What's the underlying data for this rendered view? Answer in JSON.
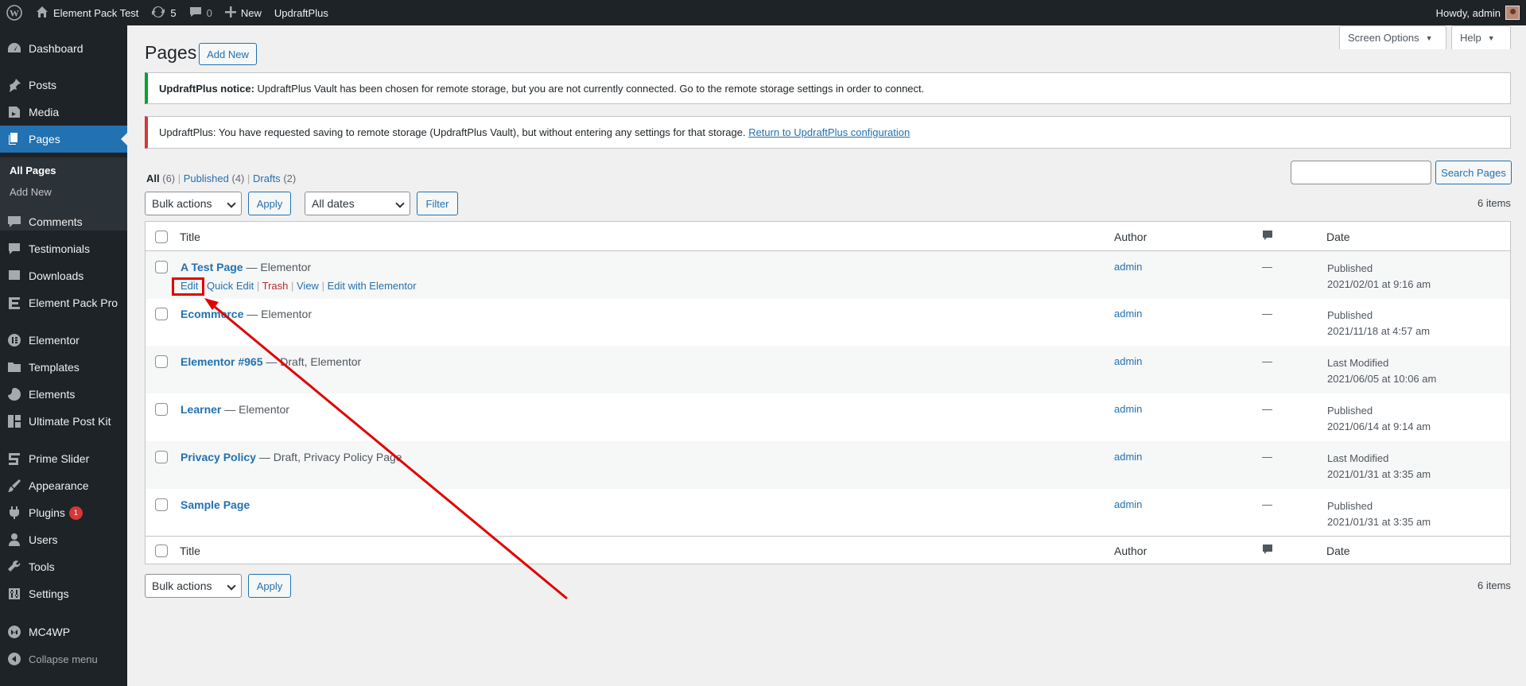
{
  "adminbar": {
    "site_name": "Element Pack Test",
    "updates_count": "5",
    "comments_count": "0",
    "new_label": "New",
    "plugin_label": "UpdraftPlus",
    "howdy": "Howdy, admin"
  },
  "sidebar": {
    "items": [
      {
        "label": "Dashboard",
        "icon": "dashboard-icon"
      },
      {
        "label": "Posts",
        "icon": "pin-icon"
      },
      {
        "label": "Media",
        "icon": "media-icon"
      },
      {
        "label": "Pages",
        "icon": "pages-icon"
      },
      {
        "label": "Comments",
        "icon": "comment-icon"
      },
      {
        "label": "Testimonials",
        "icon": "testimonial-icon"
      },
      {
        "label": "Downloads",
        "icon": "download-icon"
      },
      {
        "label": "Element Pack Pro",
        "icon": "element-pack-icon"
      },
      {
        "label": "Elementor",
        "icon": "elementor-icon"
      },
      {
        "label": "Templates",
        "icon": "folder-icon"
      },
      {
        "label": "Elements",
        "icon": "elements-icon"
      },
      {
        "label": "Ultimate Post Kit",
        "icon": "post-kit-icon"
      },
      {
        "label": "Prime Slider",
        "icon": "slider-icon"
      },
      {
        "label": "Appearance",
        "icon": "brush-icon"
      },
      {
        "label": "Plugins",
        "icon": "plugin-icon",
        "badge": "1"
      },
      {
        "label": "Users",
        "icon": "user-icon"
      },
      {
        "label": "Tools",
        "icon": "wrench-icon"
      },
      {
        "label": "Settings",
        "icon": "settings-icon"
      },
      {
        "label": "MC4WP",
        "icon": "mc4wp-icon"
      },
      {
        "label": "Collapse menu",
        "icon": "collapse-icon"
      }
    ],
    "submenu": [
      "All Pages",
      "Add New"
    ]
  },
  "header": {
    "title": "Pages",
    "add_new": "Add New",
    "screen_options": "Screen Options",
    "help": "Help"
  },
  "notices": {
    "n1_bold": "UpdraftPlus notice:",
    "n1_text": " UpdraftPlus Vault has been chosen for remote storage, but you are not currently connected. Go to the remote storage settings in order to connect.",
    "n2_text": "UpdraftPlus: You have requested saving to remote storage (UpdraftPlus Vault), but without entering any settings for that storage. ",
    "n2_link": "Return to UpdraftPlus configuration"
  },
  "filters": {
    "all": "All",
    "all_count": "(6)",
    "published": "Published",
    "published_count": "(4)",
    "drafts": "Drafts",
    "drafts_count": "(2)",
    "search_button": "Search Pages",
    "bulk_actions": "Bulk actions",
    "apply": "Apply",
    "all_dates": "All dates",
    "filter": "Filter",
    "items_count": "6 items"
  },
  "table": {
    "col_title": "Title",
    "col_author": "Author",
    "col_date": "Date",
    "row_actions": {
      "edit": "Edit",
      "quick_edit": "Quick Edit",
      "trash": "Trash",
      "view": "View",
      "edit_elementor": "Edit with Elementor"
    },
    "rows": [
      {
        "title": "A Test Page",
        "state": " — Elementor",
        "author": "admin",
        "comments": "—",
        "status": "Published",
        "date": "2021/02/01 at 9:16 am"
      },
      {
        "title": "Ecommerce",
        "state": " — Elementor",
        "author": "admin",
        "comments": "—",
        "status": "Published",
        "date": "2021/11/18 at 4:57 am"
      },
      {
        "title": "Elementor #965",
        "state": " — Draft, Elementor",
        "author": "admin",
        "comments": "—",
        "status": "Last Modified",
        "date": "2021/06/05 at 10:06 am"
      },
      {
        "title": "Learner",
        "state": " — Elementor",
        "author": "admin",
        "comments": "—",
        "status": "Published",
        "date": "2021/06/14 at 9:14 am"
      },
      {
        "title": "Privacy Policy",
        "state": " — Draft, Privacy Policy Page",
        "author": "admin",
        "comments": "—",
        "status": "Last Modified",
        "date": "2021/01/31 at 3:35 am"
      },
      {
        "title": "Sample Page",
        "state": "",
        "author": "admin",
        "comments": "—",
        "status": "Published",
        "date": "2021/01/31 at 3:35 am"
      }
    ]
  },
  "colors": {
    "accent": "#2271b1",
    "admin_dark": "#1d2327",
    "annotation_red": "#e10000",
    "notice_green": "#00a32a",
    "notice_red": "#d63638"
  }
}
